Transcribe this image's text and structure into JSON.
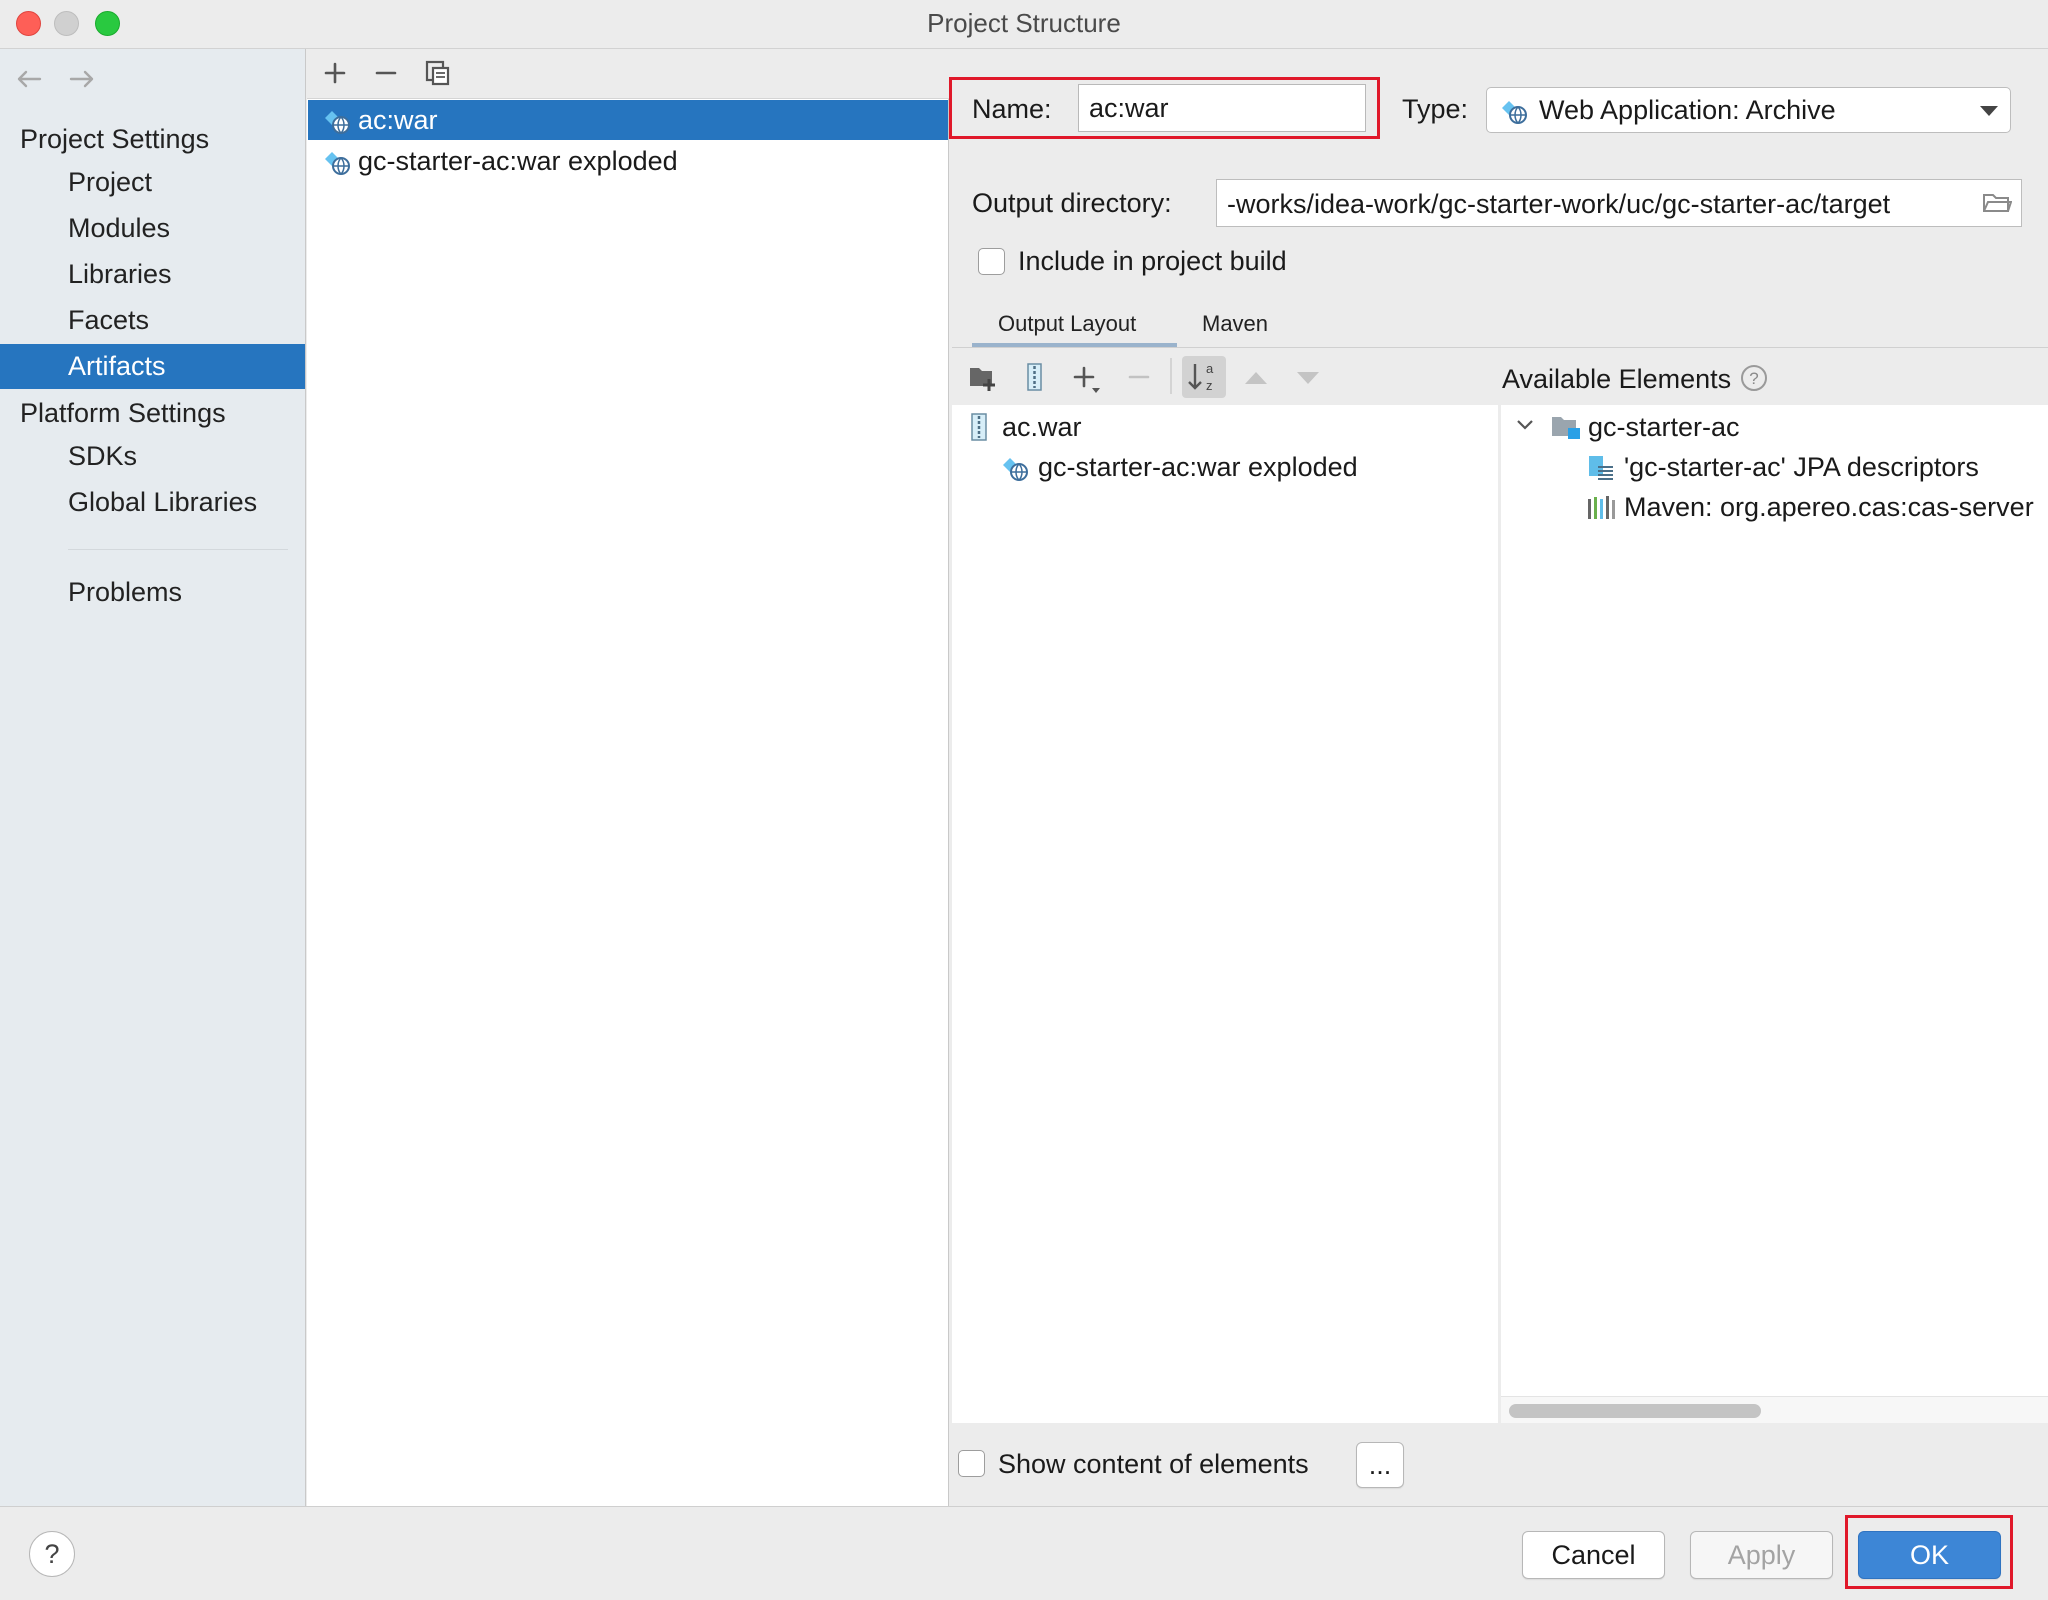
{
  "window": {
    "title": "Project Structure"
  },
  "nav": {
    "back_icon": "arrow-left-icon",
    "forward_icon": "arrow-right-icon",
    "project_settings_header": "Project Settings",
    "project_settings_items": [
      "Project",
      "Modules",
      "Libraries",
      "Facets",
      "Artifacts"
    ],
    "selected_item": "Artifacts",
    "platform_settings_header": "Platform Settings",
    "platform_settings_items": [
      "SDKs",
      "Global Libraries"
    ],
    "problems": "Problems"
  },
  "artifacts_list": {
    "toolbar_icons": [
      "add-icon",
      "remove-icon",
      "copy-icon"
    ],
    "items": [
      "ac:war",
      "gc-starter-ac:war exploded"
    ],
    "selected": "ac:war"
  },
  "artifact": {
    "name_label": "Name:",
    "name_value": "ac:war",
    "type_label": "Type:",
    "type_value": "Web Application: Archive",
    "output_dir_label": "Output directory:",
    "output_dir_value": "-works/idea-work/gc-starter-work/uc/gc-starter-ac/target",
    "include_in_build_label": "Include in project build",
    "include_in_build_checked": false
  },
  "tabs": {
    "items": [
      "Output Layout",
      "Maven"
    ],
    "active": "Output Layout"
  },
  "layout": {
    "toolbar_icons": [
      "new-folder-icon",
      "archive-icon",
      "add-icon",
      "remove-icon",
      "sort-alpha-icon",
      "move-up-icon",
      "move-down-icon"
    ],
    "root": "ac.war",
    "child": "gc-starter-ac:war exploded"
  },
  "available_elements": {
    "title": "Available Elements",
    "help_icon": "help-circle-icon",
    "root": "gc-starter-ac",
    "children": [
      "'gc-starter-ac' JPA descriptors",
      "Maven: org.apereo.cas:cas-server"
    ]
  },
  "footer": {
    "show_content_label": "Show content of elements",
    "show_content_checked": false,
    "ellipsis_button": "...",
    "help_button": "?",
    "cancel": "Cancel",
    "apply": "Apply",
    "ok": "OK"
  },
  "colors": {
    "selection": "#2675bf",
    "highlight_box": "#e0182a",
    "ok_button": "#3d86d6"
  }
}
